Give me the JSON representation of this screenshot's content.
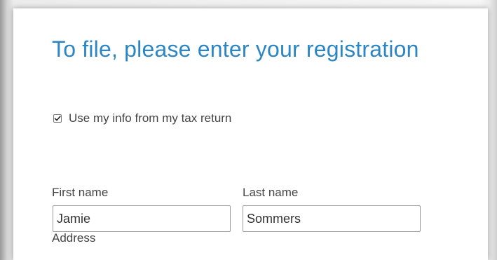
{
  "page": {
    "title": "To file, please enter your registration",
    "checkbox_label": "Use my info from my tax return",
    "checkbox_checked": true
  },
  "form": {
    "first_name": {
      "label": "First name",
      "value": "Jamie"
    },
    "last_name": {
      "label": "Last name",
      "value": "Sommers"
    },
    "address": {
      "label": "Address"
    }
  },
  "colors": {
    "title_blue": "#2d86c4",
    "text_gray": "#444444",
    "input_border": "#9a9a9a"
  }
}
